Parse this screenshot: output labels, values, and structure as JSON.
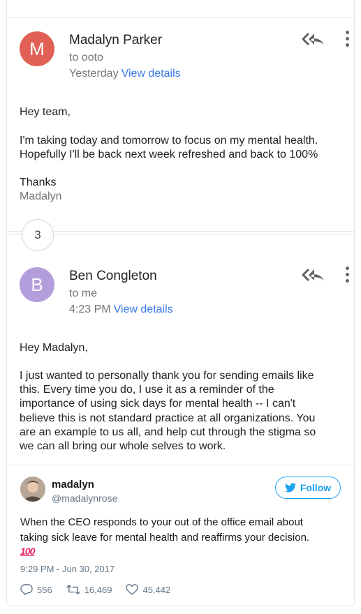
{
  "emails": [
    {
      "avatar_letter": "M",
      "avatar_color": "#e06055",
      "sender": "Madalyn Parker",
      "to": "to ooto",
      "when": "Yesterday",
      "view_details": "View details",
      "greeting": "Hey team,",
      "body_lines": [
        "I'm taking today and tomorrow to focus on my mental health.",
        "Hopefully I'll be back next week refreshed and back to 100%"
      ],
      "signoff": "Thanks",
      "signature": "Madalyn"
    },
    {
      "avatar_letter": "B",
      "avatar_color": "#b39ddb",
      "sender": "Ben Congleton",
      "to": "to me",
      "when": "4:23 PM",
      "view_details": "View details",
      "greeting": "Hey Madalyn,",
      "body_lines": [
        "I just wanted to personally thank you for sending emails like",
        "this.  Every time you do, I use it as a reminder of the",
        "importance of using sick days for mental health -- I can't",
        "believe this is not standard practice at all organizations.  You",
        "are an example to us all, and help cut through the stigma so",
        "we can all bring our whole selves to work."
      ]
    }
  ],
  "collapsed_count": "3",
  "tweet": {
    "name": "madalyn",
    "handle": "@madalynrose",
    "follow_label": "Follow",
    "text_lines": [
      "When the CEO responds to your out of the office email about",
      "taking sick leave for mental health and reaffirms your decision."
    ],
    "emoji": "100",
    "timestamp": "9:29 PM - Jun 30, 2017",
    "replies": "556",
    "retweets": "16,469",
    "likes": "45,442",
    "brand_color": "#1da1f2"
  }
}
